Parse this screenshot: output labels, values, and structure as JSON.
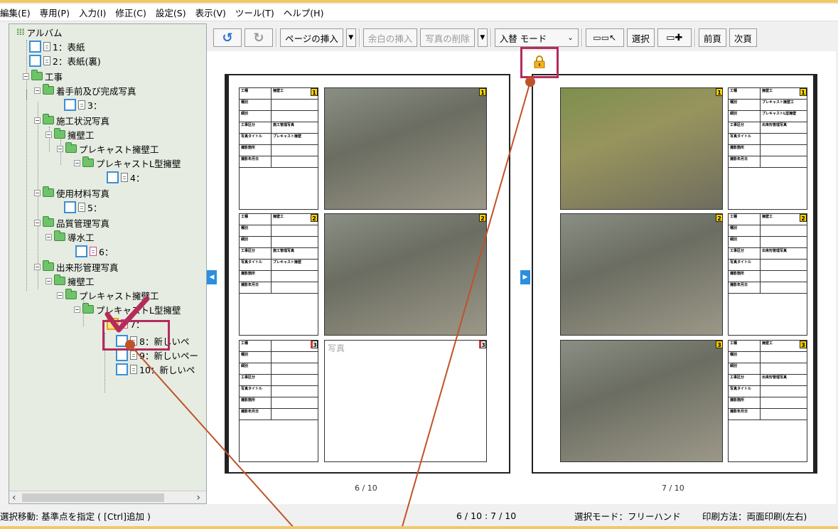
{
  "menu": [
    "編集(E)",
    "専用(P)",
    "入力(I)",
    "修正(C)",
    "設定(S)",
    "表示(V)",
    "ツール(T)",
    "ヘルプ(H)"
  ],
  "tree": {
    "root": "アルバム",
    "n1": "1：表紙",
    "n2": "2：表紙(裏)",
    "koji": "工事",
    "chakushu": "着手前及び完成写真",
    "n3": "3：",
    "seko": "施工状況写真",
    "yoheki": "擁壁工",
    "precast": "プレキャスト擁壁工",
    "precastL": "プレキャストL型擁壁",
    "n4": "4：",
    "shiyo": "使用材料写真",
    "n5": "5：",
    "hinshitsu": "品質管理写真",
    "dosui": "導水工",
    "n6": "6：",
    "dekigata": "出来形管理写真",
    "yoheki2": "擁壁工",
    "precast2": "プレキャスト擁壁工",
    "precastL2": "プレキャストL型擁壁",
    "n7": "7：",
    "n8": "8：新しいペ",
    "n9": "9：新しいペー",
    "n10": "10：新しいペ"
  },
  "toolbar": {
    "insert_page": "ページの挿入",
    "insert_margin": "余白の挿入",
    "delete_photo": "写真の削除",
    "mode": "入替 モード",
    "select": "選択",
    "prev": "前頁",
    "next": "次頁"
  },
  "pages": {
    "left_num": "6 / 10",
    "right_num": "7 / 10",
    "empty_photo_label": "写真"
  },
  "status": {
    "hint": "選択移動: 基準点を指定 ( [Ctrl]追加 )",
    "pages": "6 / 10 : 7 / 10",
    "select_mode": "選択モード：フリーハンド",
    "print_mode": "印刷方法：両面印刷(左右)"
  },
  "colors": {
    "accent": "#b52b5c",
    "lock": "#e8a317",
    "tree_bg": "#e6ece2"
  }
}
